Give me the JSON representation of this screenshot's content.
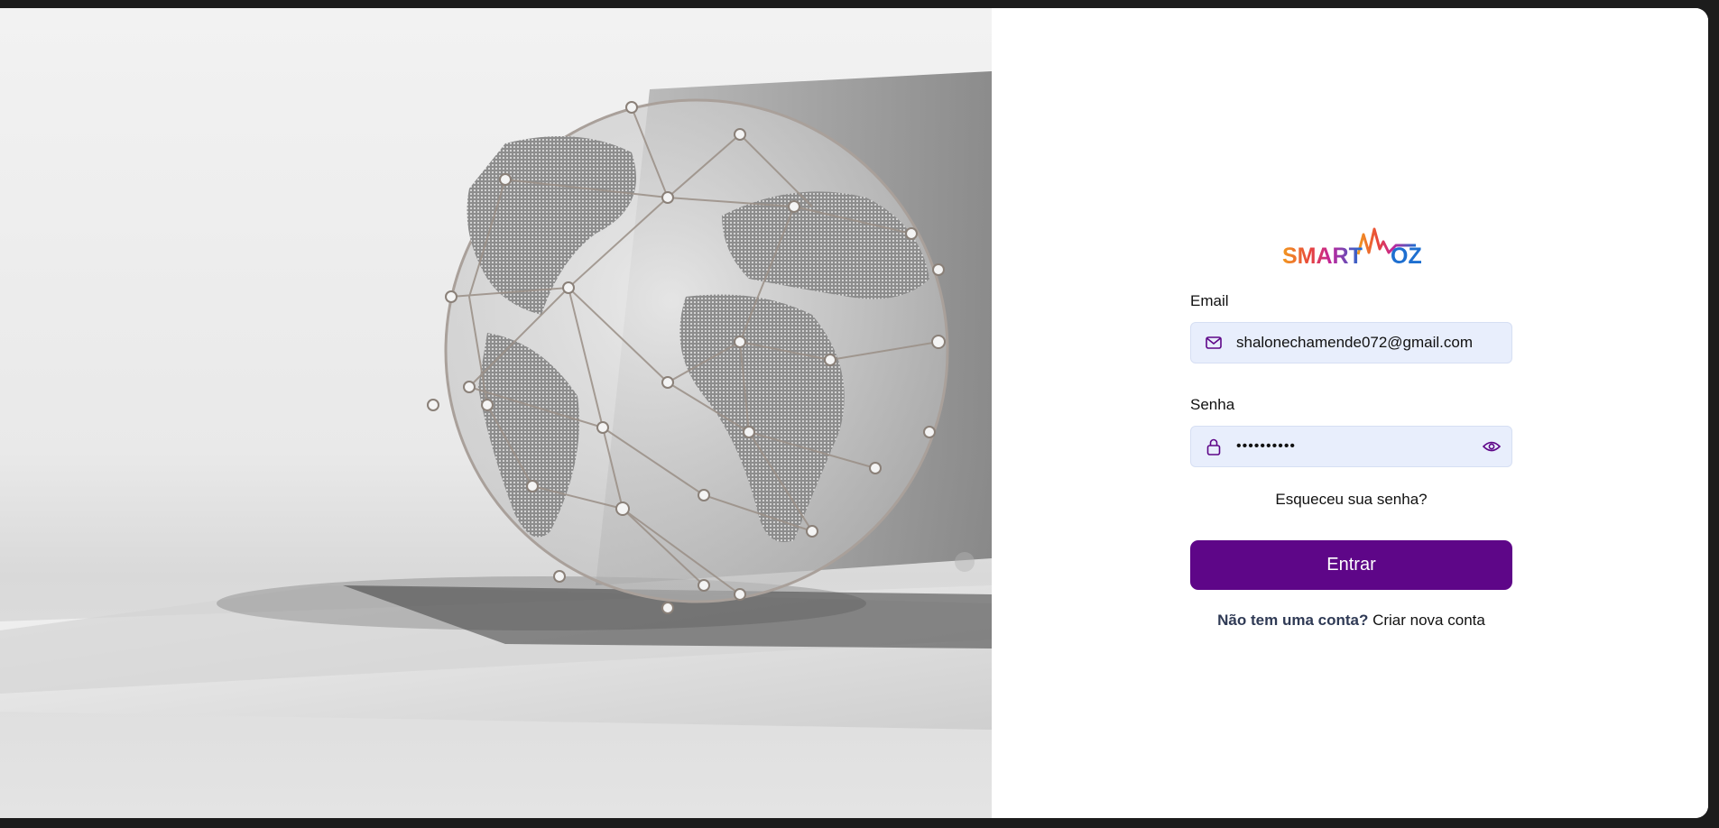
{
  "hero": {
    "image": "globe-network-on-laptop"
  },
  "brand": {
    "logo_text": "SMARTVOZ"
  },
  "form": {
    "email_label": "Email",
    "email_value": "shalonechamende072@gmail.com",
    "password_label": "Senha",
    "password_value": "••••••••••",
    "forgot_label": "Esqueceu sua senha?",
    "submit_label": "Entrar",
    "no_account_label": "Não tem uma conta?",
    "create_account_label": "Criar nova conta"
  },
  "icons": {
    "email": "mail-icon",
    "password": "lock-icon",
    "toggle": "eye-icon"
  },
  "colors": {
    "accent": "#5e0688",
    "input_bg": "#e8eefc",
    "link_dark": "#2f3a55"
  }
}
